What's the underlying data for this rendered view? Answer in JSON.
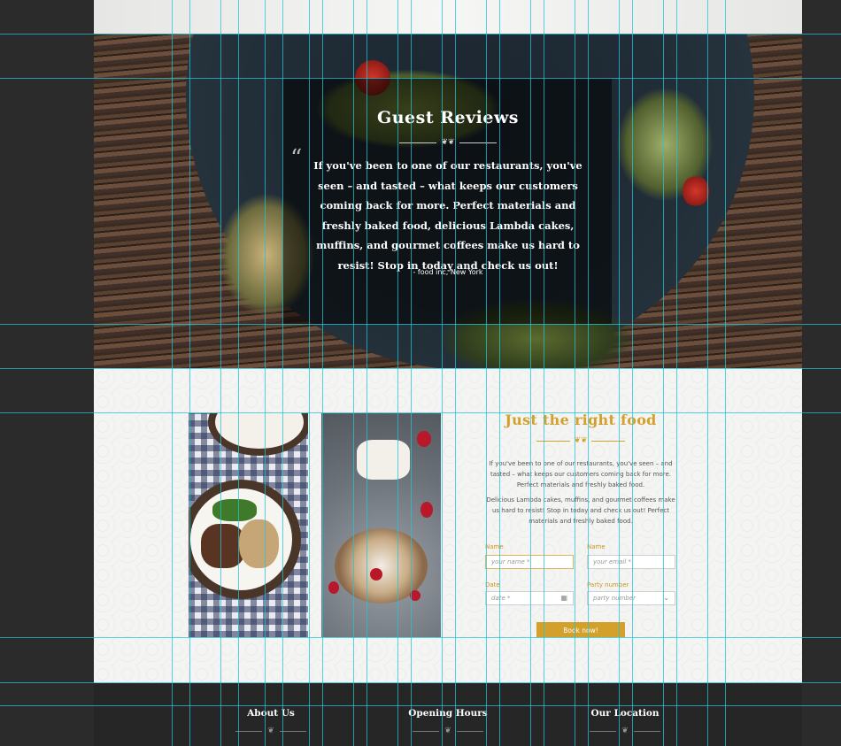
{
  "hero": {
    "title": "Guest Reviews",
    "quote_mark": "“",
    "quote": "If you've been to one of our restaurants, you've seen – and tasted – what keeps our customers coming back for more. Perfect materials and freshly baked food, delicious Lambda cakes,  muffins, and gourmet coffees make us hard to resist! Stop in today and check us out!",
    "author": "- food inc, New York"
  },
  "booking": {
    "title": "Just the right food",
    "paragraph_1": "If you've been to one of our restaurants, you've seen – and tasted – what keeps our customers coming back for more. Perfect materials and freshly baked food.",
    "paragraph_2": "Delicious Lambda cakes,  muffins, and gourmet coffees make us hard to resist! Stop in today and check us out! Perfect materials and freshly baked food.",
    "form": {
      "name_label": "Name",
      "name_placeholder": "your name *",
      "email_label": "Name",
      "email_placeholder": "your email *",
      "date_label": "Date",
      "date_placeholder": "date *",
      "party_label": "Party number",
      "party_placeholder": "party number",
      "submit_label": "Book now!"
    }
  },
  "footer": {
    "about_title": "About Us",
    "hours_title": "Opening Hours",
    "location_title": "Our Location"
  },
  "colors": {
    "accent": "#d4a02c",
    "guide": "#20c4d8",
    "footer_bg": "#262626"
  },
  "icons": {
    "quote": "quote-icon",
    "calendar": "calendar-icon",
    "chevron": "chevron-down-icon",
    "ornament": "ornament-divider-icon"
  }
}
